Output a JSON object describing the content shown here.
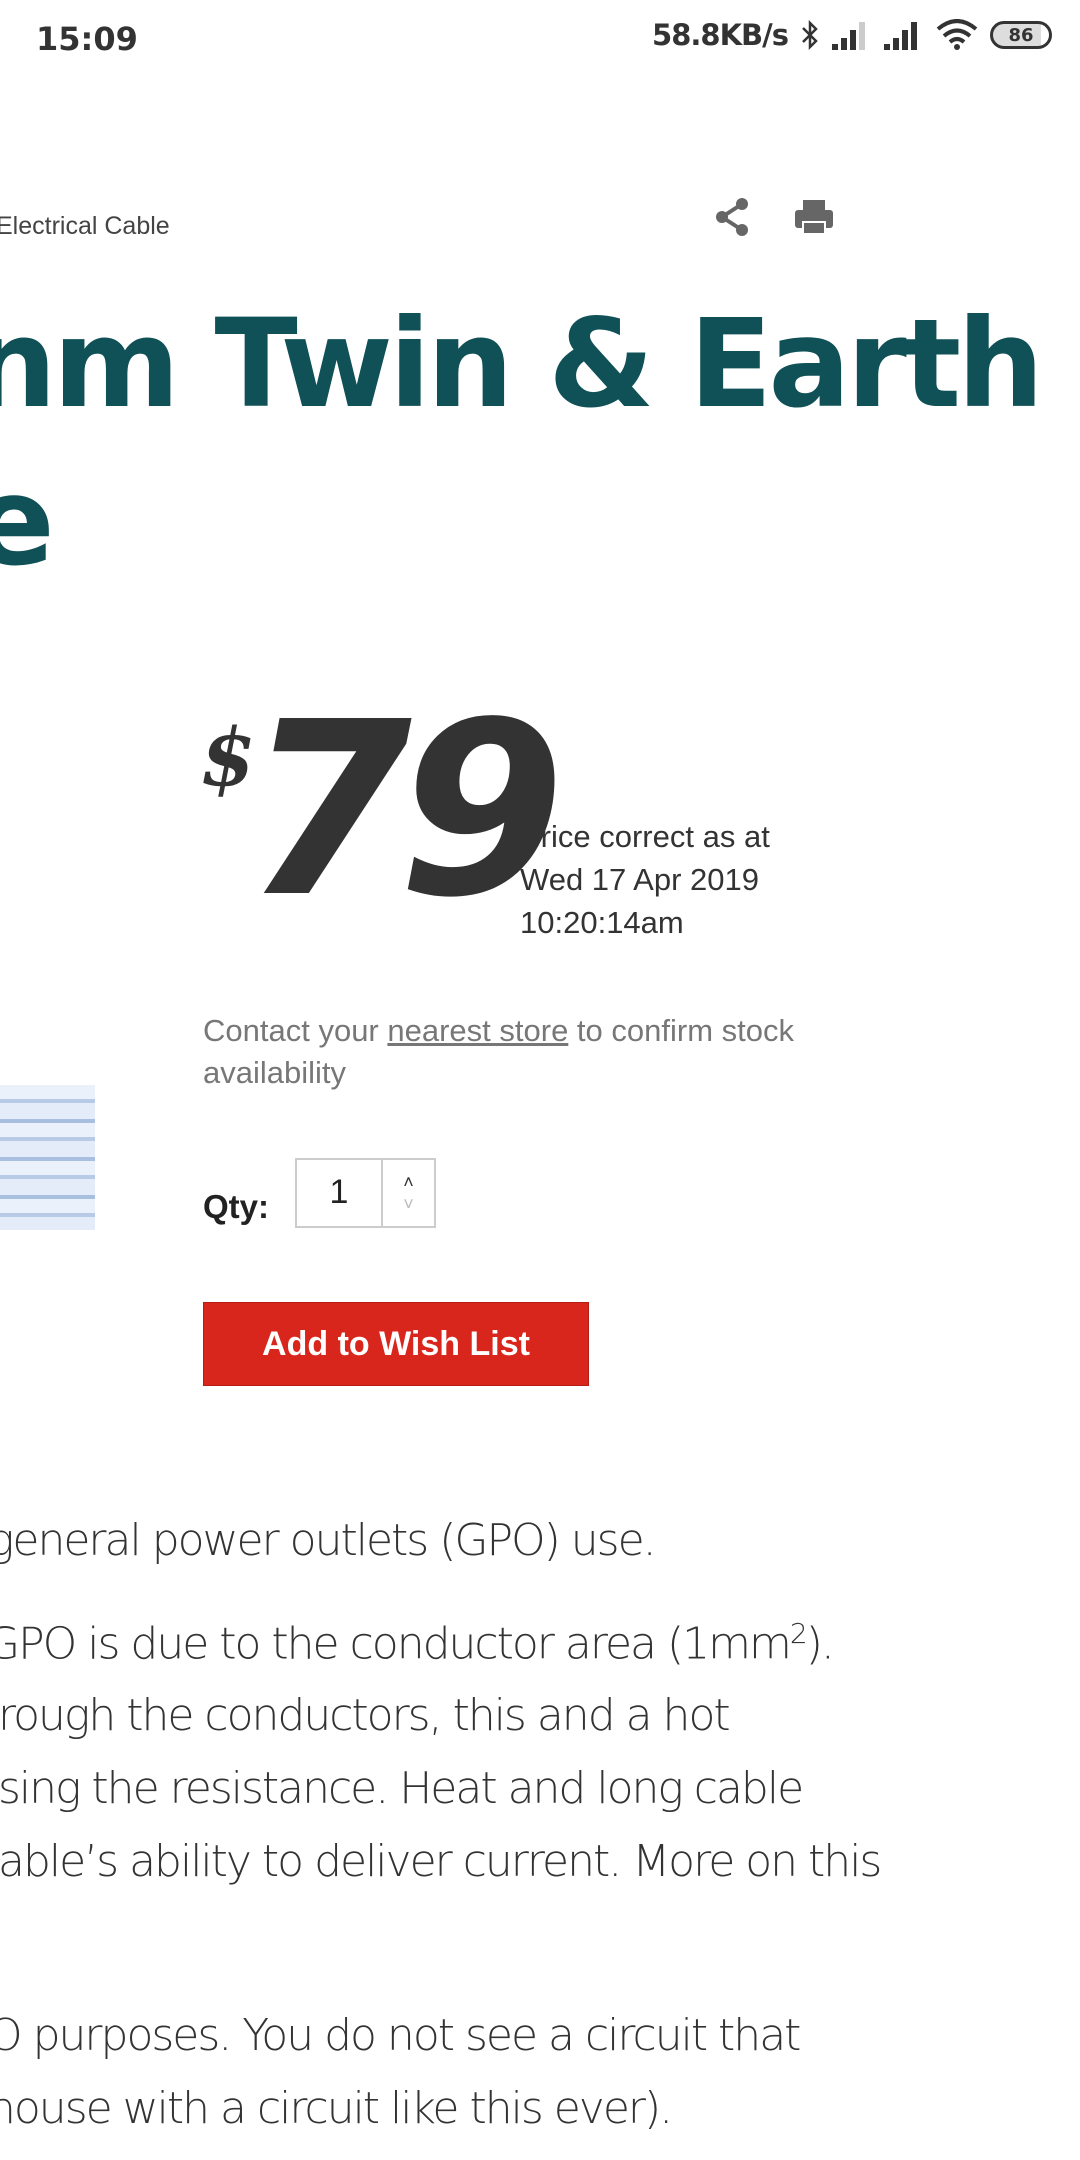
{
  "status_bar": {
    "time": "15:09",
    "net_speed": "58.8KB/s",
    "battery": "86",
    "icons": [
      "bluetooth-icon",
      "signal-icon",
      "signal-icon",
      "wifi-icon",
      "battery-icon"
    ]
  },
  "breadcrumb": {
    "current": "Electrical Cable"
  },
  "actions": {
    "icons": [
      "share-icon",
      "print-icon"
    ]
  },
  "product": {
    "title_line1": "nm Twin & Earth",
    "title_line2": "e",
    "currency": "$",
    "price": "79",
    "price_note": [
      "Price correct as at",
      "Wed 17 Apr 2019",
      "10:20:14am"
    ],
    "contact_before": "Contact your ",
    "contact_link": "nearest store",
    "contact_after": " to confirm stock availability",
    "qty_label": "Qty:",
    "qty_value": "1",
    "wishlist_button": "Add to Wish List",
    "colors": {
      "title": "#0f5157",
      "button": "#d9261c"
    }
  },
  "article": {
    "lines": [
      "general power outlets (GPO) use.",
      "GPO is due to the conductor area (1mm",
      "rough the conductors, this and a hot",
      "sing the resistance. Heat and long cable",
      "able’s ability to deliver current. More on this",
      "O purposes. You do not see a circuit that",
      "house with a circuit like this ever)."
    ],
    "sup": "2",
    "after_sup": ")."
  }
}
